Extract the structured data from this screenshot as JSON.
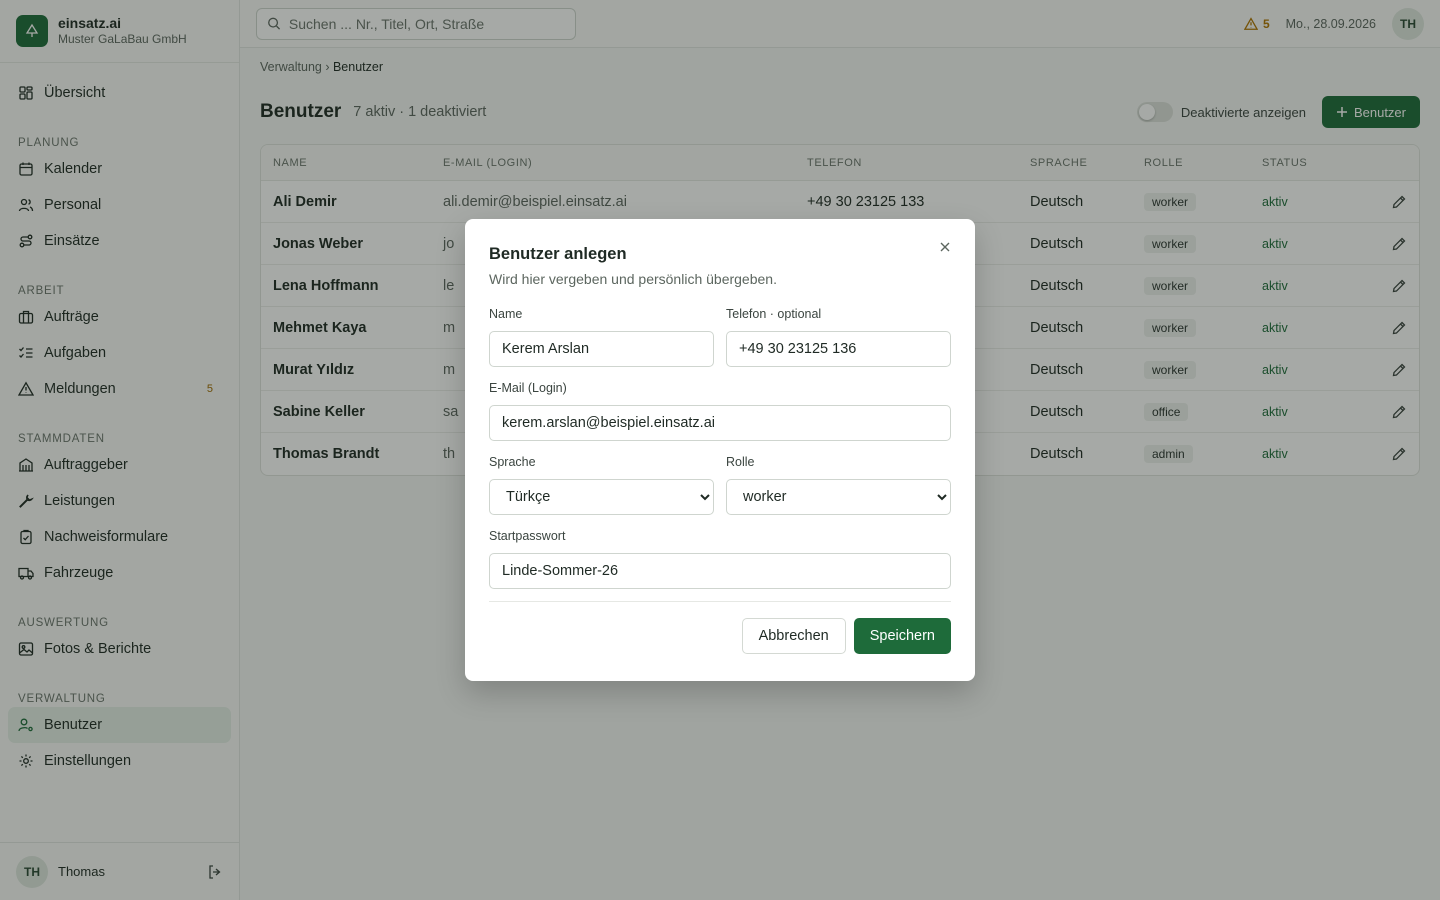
{
  "app": {
    "name": "einsatz.ai",
    "company": "Muster GaLaBau GmbH"
  },
  "colors": {
    "brand": "#1e6b3a",
    "warning": "#b07400"
  },
  "header": {
    "search_placeholder": "Suchen ... Nr., Titel, Ort, Straße",
    "alert_count": "5",
    "date": "Mo., 28.09.2026",
    "user_initials": "TH"
  },
  "sidebar": {
    "overview": "Übersicht",
    "sections": {
      "planung": "PLANUNG",
      "arbeit": "ARBEIT",
      "stammdaten": "STAMMDATEN",
      "auswertung": "AUSWERTUNG",
      "verwaltung": "VERWALTUNG"
    },
    "items": {
      "kalender": "Kalender",
      "personal": "Personal",
      "einsaetze": "Einsätze",
      "auftraege": "Aufträge",
      "aufgaben": "Aufgaben",
      "meldungen": "Meldungen",
      "meldungen_badge": "5",
      "auftraggeber": "Auftraggeber",
      "leistungen": "Leistungen",
      "nachweisformulare": "Nachweisformulare",
      "fahrzeuge": "Fahrzeuge",
      "fotos": "Fotos & Berichte",
      "benutzer": "Benutzer",
      "einstellungen": "Einstellungen"
    },
    "footer": {
      "initials": "TH",
      "name": "Thomas"
    }
  },
  "main": {
    "breadcrumb_parent": "Verwaltung",
    "breadcrumb_sep": " › ",
    "breadcrumb_current": "Benutzer",
    "title": "Benutzer",
    "subtitle": "7 aktiv · 1 deaktiviert",
    "toggle_label": "Deaktivierte anzeigen",
    "add_button": "Benutzer",
    "columns": [
      "NAME",
      "E-MAIL (LOGIN)",
      "TELEFON",
      "SPRACHE",
      "ROLLE",
      "STATUS"
    ],
    "rows": [
      {
        "name": "Ali Demir",
        "email": "ali.demir@beispiel.einsatz.ai",
        "phone": "+49 30 23125 133",
        "lang": "Deutsch",
        "role": "worker",
        "status": "aktiv"
      },
      {
        "name": "Jonas Weber",
        "email": "jo",
        "phone": "",
        "lang": "Deutsch",
        "role": "worker",
        "status": "aktiv"
      },
      {
        "name": "Lena Hoffmann",
        "email": "le",
        "phone": "",
        "lang": "Deutsch",
        "role": "worker",
        "status": "aktiv"
      },
      {
        "name": "Mehmet Kaya",
        "email": "m",
        "phone": "",
        "lang": "Deutsch",
        "role": "worker",
        "status": "aktiv"
      },
      {
        "name": "Murat Yıldız",
        "email": "m",
        "phone": "",
        "lang": "Deutsch",
        "role": "worker",
        "status": "aktiv"
      },
      {
        "name": "Sabine Keller",
        "email": "sa",
        "phone": "",
        "lang": "Deutsch",
        "role": "office",
        "status": "aktiv"
      },
      {
        "name": "Thomas Brandt",
        "email": "th",
        "phone": "",
        "lang": "Deutsch",
        "role": "admin",
        "status": "aktiv"
      }
    ]
  },
  "modal": {
    "title": "Benutzer anlegen",
    "subtitle": "Wird hier vergeben und persönlich übergeben.",
    "name_label": "Name",
    "name_value": "Kerem Arslan",
    "phone_label": "Telefon · optional",
    "phone_value": "+49 30 23125 136",
    "email_label": "E-Mail (Login)",
    "email_value": "kerem.arslan@beispiel.einsatz.ai",
    "lang_label": "Sprache",
    "lang_value": "Türkçe",
    "role_label": "Rolle",
    "role_value": "worker",
    "password_label": "Startpasswort",
    "password_value": "Linde-Sommer-26",
    "cancel": "Abbrechen",
    "save": "Speichern"
  }
}
